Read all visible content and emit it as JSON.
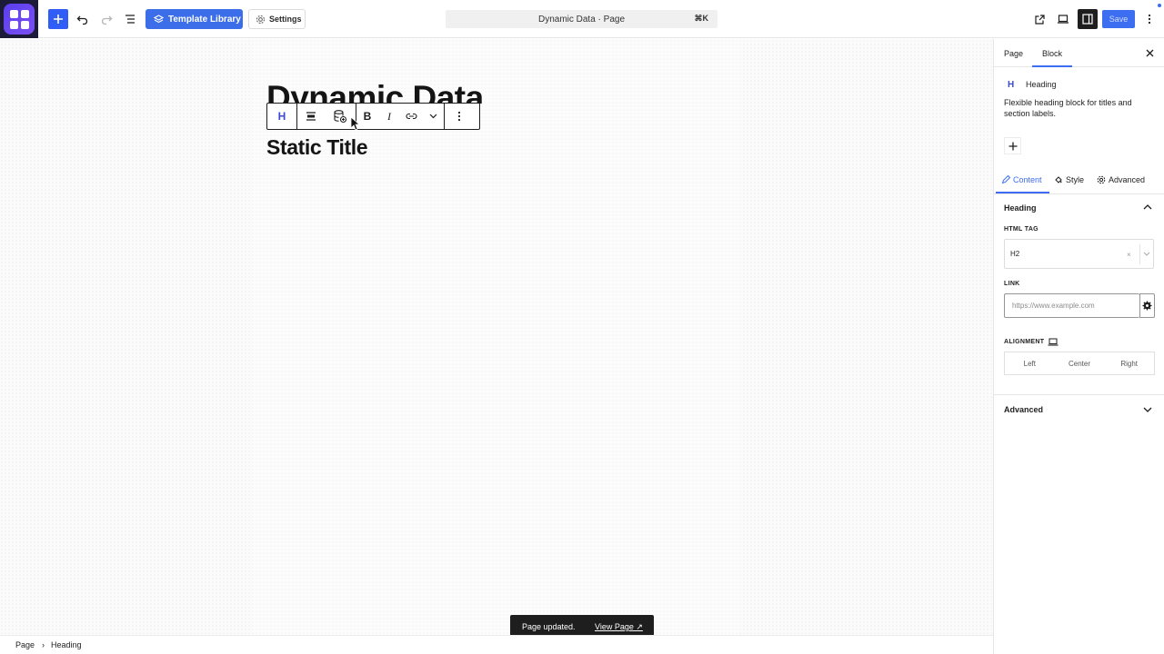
{
  "topbar": {
    "template_library_label": "Template Library",
    "settings_label": "Settings",
    "command_title": "Dynamic Data · Page",
    "command_shortcut": "⌘K",
    "save_label": "Save"
  },
  "canvas": {
    "heading_dynamic": "Dynamic Data",
    "heading_static": "Static Title",
    "block_toolbar": {
      "block_type_glyph": "H",
      "bold_glyph": "B",
      "italic_glyph": "I"
    }
  },
  "snackbar": {
    "message": "Page updated.",
    "link_label": "View Page ↗"
  },
  "footer": {
    "breadcrumb": [
      "Page",
      "Heading"
    ],
    "separator": "›"
  },
  "sidebar": {
    "tabs": [
      "Page",
      "Block"
    ],
    "active_tab": "Block",
    "block_card": {
      "icon_glyph": "H",
      "title": "Heading",
      "description": "Flexible heading block for titles and section labels."
    },
    "sub_tabs": [
      "Content",
      "Style",
      "Advanced"
    ],
    "active_sub_tab": "Content",
    "panel_title": "Heading",
    "html_tag": {
      "label": "HTML TAG",
      "value": "H2",
      "clear_glyph": "×"
    },
    "link": {
      "label": "LINK",
      "placeholder": "https://www.example.com"
    },
    "alignment": {
      "label": "ALIGNMENT",
      "options": [
        "Left",
        "Center",
        "Right"
      ]
    },
    "advanced_title": "Advanced"
  },
  "colors": {
    "accent": "#3d6df0",
    "brand": "#5a3ff0",
    "dark": "#1e1e1e"
  }
}
